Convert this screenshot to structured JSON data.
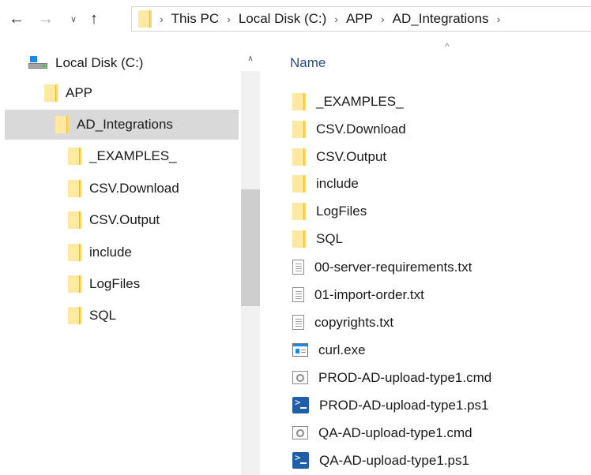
{
  "address_bar": {
    "back_glyph": "←",
    "forward_glyph": "→",
    "recent_glyph": "∨",
    "up_glyph": "↑",
    "separator": "›",
    "breadcrumbs": [
      "This PC",
      "Local Disk (C:)",
      "APP",
      "AD_Integrations"
    ]
  },
  "nav_pane": {
    "scroll_up_glyph": "∧",
    "drive": {
      "label": "Local Disk (C:)",
      "icon": "drive-icon"
    },
    "app": {
      "label": "APP",
      "icon": "folder-icon"
    },
    "selected": {
      "label": "AD_Integrations",
      "icon": "folder-icon"
    },
    "subfolders": [
      "_EXAMPLES_",
      "CSV.Download",
      "CSV.Output",
      "include",
      "LogFiles",
      "SQL"
    ]
  },
  "content": {
    "column_header": "Name",
    "sort_glyph": "^",
    "items": [
      {
        "name": "_EXAMPLES_",
        "icon": "folder-icon"
      },
      {
        "name": "CSV.Download",
        "icon": "folder-icon"
      },
      {
        "name": "CSV.Output",
        "icon": "folder-icon"
      },
      {
        "name": "include",
        "icon": "folder-icon"
      },
      {
        "name": "LogFiles",
        "icon": "folder-icon"
      },
      {
        "name": "SQL",
        "icon": "folder-icon"
      },
      {
        "name": "00-server-requirements.txt",
        "icon": "text-file-icon"
      },
      {
        "name": "01-import-order.txt",
        "icon": "text-file-icon"
      },
      {
        "name": "copyrights.txt",
        "icon": "text-file-icon"
      },
      {
        "name": "curl.exe",
        "icon": "exe-file-icon"
      },
      {
        "name": "PROD-AD-upload-type1.cmd",
        "icon": "cmd-file-icon"
      },
      {
        "name": "PROD-AD-upload-type1.ps1",
        "icon": "powershell-file-icon"
      },
      {
        "name": "QA-AD-upload-type1.cmd",
        "icon": "cmd-file-icon"
      },
      {
        "name": "QA-AD-upload-type1.ps1",
        "icon": "powershell-file-icon"
      }
    ]
  },
  "colors": {
    "selection": "#d9d9d9",
    "folder": "#ffd66b",
    "header_text": "#2b4c7e",
    "powershell": "#1e5fa8"
  }
}
